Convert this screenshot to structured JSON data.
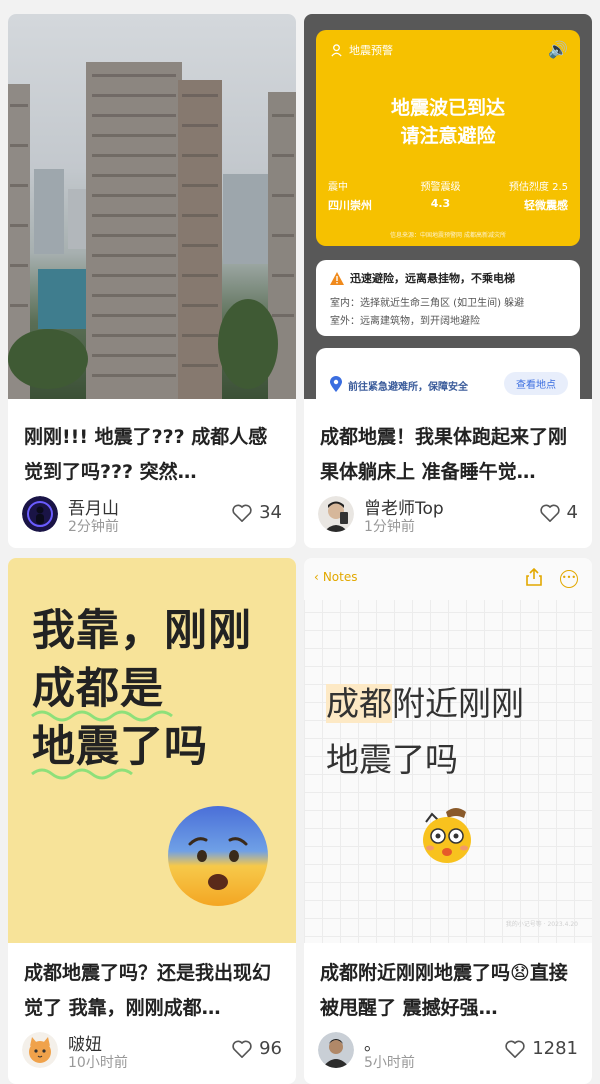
{
  "posts": [
    {
      "title": "刚刚!!! 地震了??? 成都人感觉到了吗??? 突然…",
      "author": "吾月山",
      "time": "2分钟前",
      "likes": "34"
    },
    {
      "title": "成都地震！我果体跑起来了刚果体躺床上 准备睡午觉…",
      "author": "曾老师Top",
      "time": "1分钟前",
      "likes": "4",
      "alert": {
        "header": "地震预警",
        "line1": "地震波已到达",
        "line2": "请注意避险",
        "stats": [
          {
            "label": "震中",
            "value": "四川崇州"
          },
          {
            "label": "预警震级",
            "value": "4.3"
          },
          {
            "label": "预估烈度 2.5",
            "value": "轻微震感"
          }
        ],
        "source": "信息来源：中国地震预警网 成都高新减灾所",
        "tip_title": "迅速避险，远离悬挂物，不乘电梯",
        "tip_indoor": "室内：选择就近生命三角区 (如卫生间) 躲避",
        "tip_outdoor": "室外：远离建筑物，到开阔地避险",
        "shelter_text": "前往紧急避难所，保障安全",
        "shelter_button": "查看地点"
      }
    },
    {
      "title": "成都地震了吗？还是我出现幻觉了 我靠，刚刚成都…",
      "author": "啵妞",
      "time": "10小时前",
      "likes": "96",
      "image_lines": [
        "我靠，刚刚",
        "成都是",
        "地震了吗"
      ]
    },
    {
      "title": "成都附近刚刚地震了吗😧直接被甩醒了 震撼好强…",
      "author": "。",
      "time": "5小时前",
      "likes": "1281",
      "notes": {
        "back_label": "Notes",
        "highlight": "成都",
        "line1_rest": "附近刚刚",
        "line2": "地震了吗",
        "watermark": "我的小记号等 · 2023.4.20"
      }
    }
  ],
  "colors": {
    "alert_yellow": "#f6c100",
    "notes_accent": "#e2a800",
    "card3_bg": "#f7e399"
  }
}
